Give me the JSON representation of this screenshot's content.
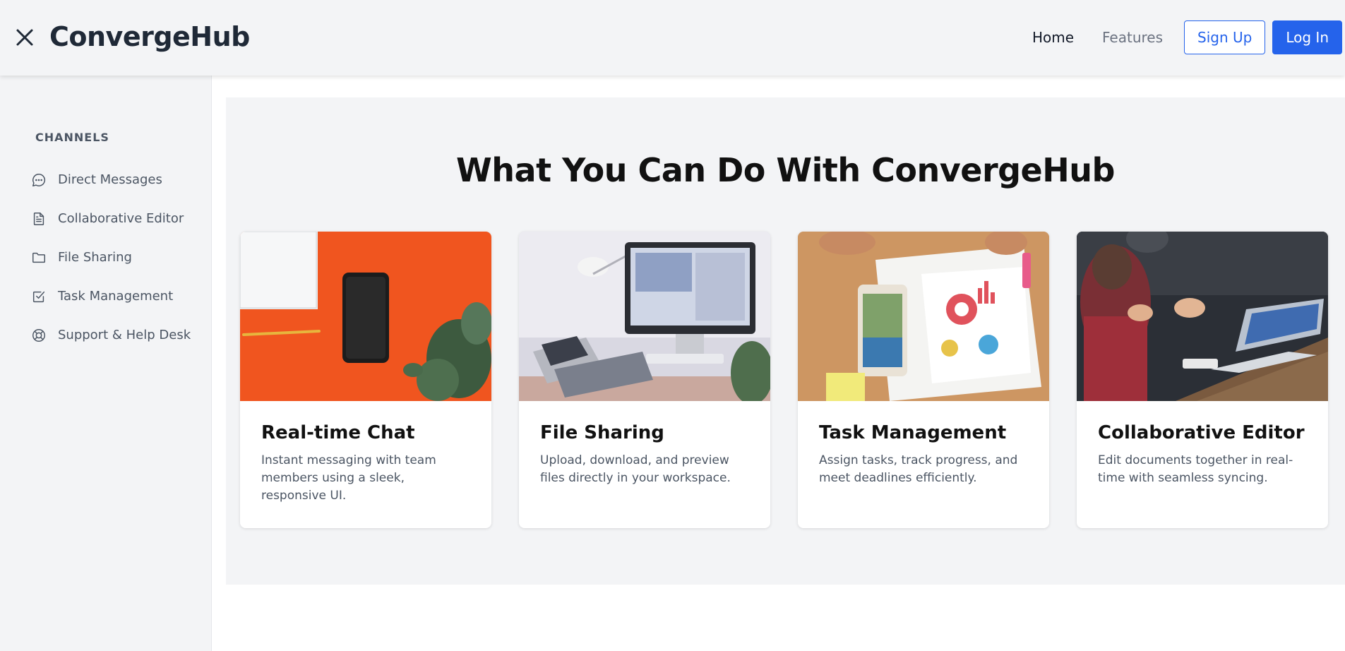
{
  "header": {
    "brand": "ConvergeHub",
    "nav": {
      "home": "Home",
      "features": "Features"
    },
    "signup_label": "Sign Up",
    "login_label": "Log In"
  },
  "sidebar": {
    "heading": "CHANNELS",
    "items": [
      {
        "label": "Direct Messages",
        "icon": "chat-bubble-icon"
      },
      {
        "label": "Collaborative Editor",
        "icon": "document-icon"
      },
      {
        "label": "File Sharing",
        "icon": "folder-icon"
      },
      {
        "label": "Task Management",
        "icon": "checkbox-icon"
      },
      {
        "label": "Support & Help Desk",
        "icon": "lifebuoy-icon"
      }
    ]
  },
  "main": {
    "title": "What You Can Do With ConvergeHub",
    "cards": [
      {
        "title": "Real-time Chat",
        "desc": "Instant messaging with team members using a sleek, responsive UI."
      },
      {
        "title": "File Sharing",
        "desc": "Upload, download, and preview files directly in your workspace."
      },
      {
        "title": "Task Management",
        "desc": "Assign tasks, track progress, and meet deadlines efficiently."
      },
      {
        "title": "Collaborative Editor",
        "desc": "Edit documents together in real-time with seamless syncing."
      }
    ]
  },
  "colors": {
    "accent": "#2563eb",
    "background": "#f3f4f6",
    "text": "#1f2937"
  }
}
